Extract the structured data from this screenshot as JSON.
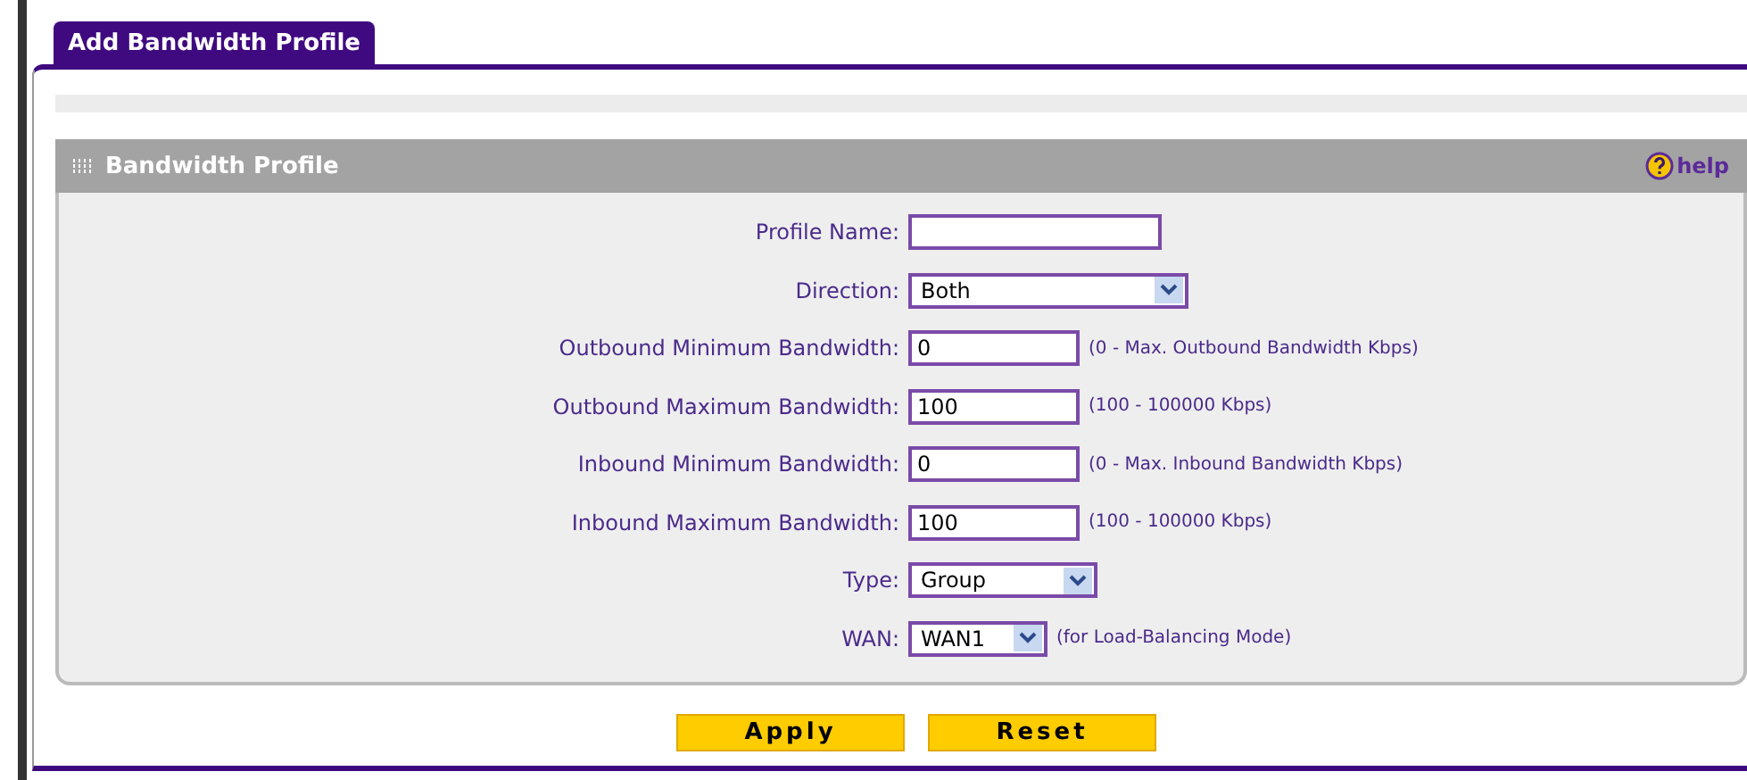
{
  "tab": {
    "label": "Add Bandwidth Profile",
    "selected": true
  },
  "section": {
    "title": "Bandwidth Profile",
    "help": "help"
  },
  "fields": [
    {
      "kind": "text",
      "label": "Profile Name:"
    },
    {
      "kind": "select",
      "label": "Direction:",
      "value": "Both"
    },
    {
      "kind": "text",
      "label": "Outbound Minimum Bandwidth:",
      "value": "0",
      "hint": "(0 - Max. Outbound Bandwidth Kbps)"
    },
    {
      "kind": "text",
      "label": "Outbound Maximum Bandwidth:",
      "value": "100",
      "hint": "(100 - 100000 Kbps)"
    },
    {
      "kind": "text",
      "label": "Inbound Minimum Bandwidth:",
      "value": "0",
      "hint": "(0 - Max. Inbound Bandwidth Kbps)"
    },
    {
      "kind": "text",
      "label": "Inbound Maximum Bandwidth:",
      "value": "100",
      "hint": "(100 - 100000 Kbps)"
    },
    {
      "kind": "select",
      "label": "Type:",
      "value": "Group"
    },
    {
      "kind": "select",
      "label": "WAN:",
      "value": "WAN1",
      "hint": "(for Load-Balancing Mode)"
    }
  ],
  "buttons": [
    "Apply",
    "Reset"
  ]
}
